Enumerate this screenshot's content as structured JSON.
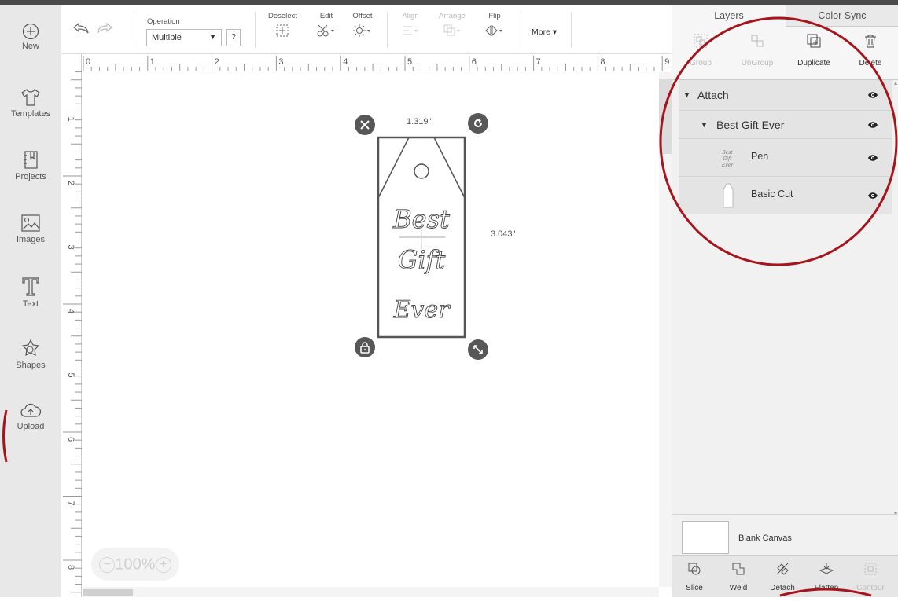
{
  "sidebar": {
    "items": [
      {
        "label": "New",
        "icon": "plus-circle-icon"
      },
      {
        "label": "Templates",
        "icon": "shirt-icon"
      },
      {
        "label": "Projects",
        "icon": "notebook-icon"
      },
      {
        "label": "Images",
        "icon": "image-icon"
      },
      {
        "label": "Text",
        "icon": "text-icon"
      },
      {
        "label": "Shapes",
        "icon": "shapes-icon"
      },
      {
        "label": "Upload",
        "icon": "cloud-upload-icon"
      }
    ]
  },
  "toolbar": {
    "operation_label": "Operation",
    "operation_value": "Multiple",
    "help_label": "?",
    "deselect_label": "Deselect",
    "edit_label": "Edit",
    "offset_label": "Offset",
    "align_label": "Align",
    "arrange_label": "Arrange",
    "flip_label": "Flip",
    "more_label": "More ▾"
  },
  "rulers": {
    "top": [
      "0",
      "1",
      "2",
      "3",
      "4",
      "5",
      "6",
      "7",
      "8",
      "9"
    ],
    "left": [
      "1",
      "2",
      "3",
      "4",
      "5",
      "6",
      "7",
      "8"
    ]
  },
  "canvas": {
    "width_label": "1.319\"",
    "height_label": "3.043\"",
    "tag_text": [
      "Best",
      "Gift",
      "Ever"
    ],
    "zoom": "100%"
  },
  "panel": {
    "tabs": [
      "Layers",
      "Color Sync"
    ],
    "actions": [
      {
        "label": "Group",
        "enabled": false
      },
      {
        "label": "UnGroup",
        "enabled": false
      },
      {
        "label": "Duplicate",
        "enabled": true
      },
      {
        "label": "Delete",
        "enabled": true
      }
    ],
    "layers": [
      {
        "name": "Attach",
        "level": 0
      },
      {
        "name": "Best Gift Ever",
        "level": 1
      },
      {
        "name": "Pen",
        "level": 2
      },
      {
        "name": "Basic Cut",
        "level": 2
      }
    ],
    "blank_canvas_label": "Blank Canvas",
    "bottom_actions": [
      {
        "label": "Slice",
        "enabled": true
      },
      {
        "label": "Weld",
        "enabled": true
      },
      {
        "label": "Detach",
        "enabled": true
      },
      {
        "label": "Flatten",
        "enabled": true
      },
      {
        "label": "Contour",
        "enabled": false
      }
    ]
  },
  "colors": {
    "annotation": "#a8141c",
    "handle": "#575757",
    "panel_bg": "#f1f1f1",
    "layer_row_bg": "#e4e4e4"
  }
}
